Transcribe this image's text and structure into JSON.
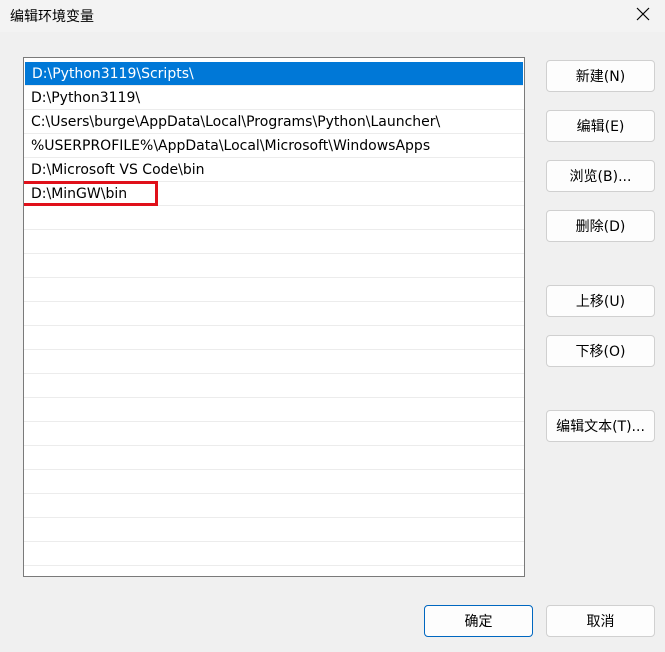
{
  "window": {
    "title": "编辑环境变量"
  },
  "list": {
    "items": [
      "D:\\Python3119\\Scripts\\",
      "D:\\Python3119\\",
      "C:\\Users\\burge\\AppData\\Local\\Programs\\Python\\Launcher\\",
      "%USERPROFILE%\\AppData\\Local\\Microsoft\\WindowsApps",
      "D:\\Microsoft VS Code\\bin",
      "D:\\MinGW\\bin"
    ],
    "selected_index": 0,
    "highlighted_index": 5
  },
  "buttons": {
    "new": "新建(N)",
    "edit": "编辑(E)",
    "browse": "浏览(B)...",
    "delete": "删除(D)",
    "move_up": "上移(U)",
    "move_down": "下移(O)",
    "edit_text": "编辑文本(T)..."
  },
  "footer": {
    "ok": "确定",
    "cancel": "取消"
  },
  "colors": {
    "selection": "#0078d7",
    "highlight_box": "#e0101a"
  }
}
